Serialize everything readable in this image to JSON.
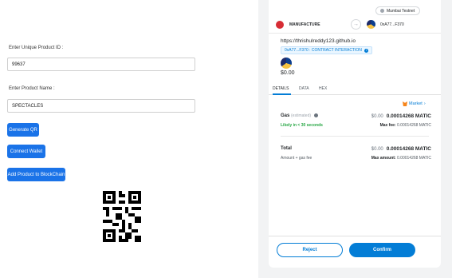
{
  "form": {
    "product_id_label": "Enter Unique Product ID :",
    "product_id_value": "99637",
    "product_name_label": "Enter Product Name :",
    "product_name_value": "SPECTACLES",
    "generate_qr_label": "Generate QR",
    "connect_wallet_label": "Connect Wallet",
    "add_product_label": "Add Product to BlockChain"
  },
  "metamask": {
    "network": "Mumbai Testnet",
    "from_account": "MANUFACTURE",
    "to_account": "0xA77...F370",
    "origin": "https://thrishulreddy123.github.io",
    "contract_label": "0xA77...F370 : CONTRACT INTERACTION",
    "amount": "$0.00",
    "tabs": [
      "DETAILS",
      "DATA",
      "HEX"
    ],
    "market_label": "Market",
    "gas": {
      "label": "Gas",
      "sub_label": "(estimated)",
      "fiat": "$0.00",
      "value": "0.00014268 MATIC",
      "likely": "Likely in < 30 seconds",
      "max_fee_label": "Max fee:",
      "max_fee_value": "0.00014268 MATIC"
    },
    "total": {
      "label": "Total",
      "fiat": "$0.00",
      "value": "0.00014268 MATIC",
      "sub_label": "Amount + gas fee",
      "max_amount_label": "Max amount:",
      "max_amount_value": "0.00014268 MATIC"
    },
    "reject_label": "Reject",
    "confirm_label": "Confirm",
    "colors": {
      "primary": "#037dd6",
      "success": "#28a745",
      "form_button": "#1a73e8"
    }
  }
}
